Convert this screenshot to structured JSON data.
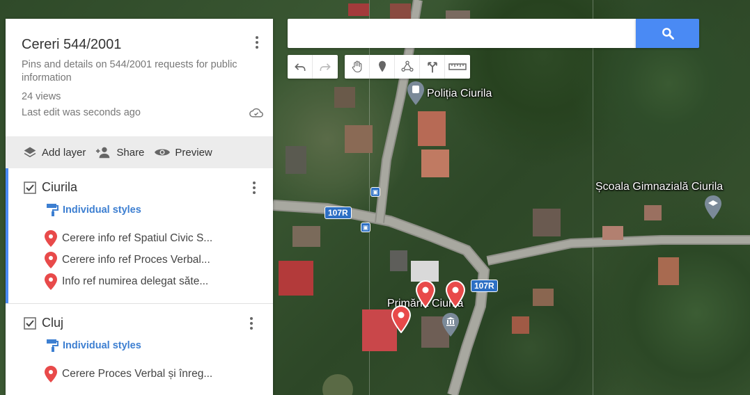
{
  "map": {
    "labels": {
      "police": "Poliția Ciurila",
      "school": "Școala Gimnazială Ciurila",
      "townhall": "Primăria Ciurila"
    },
    "route_shields": [
      "107R",
      "107R"
    ]
  },
  "search": {
    "value": "",
    "placeholder": ""
  },
  "toolbar": {
    "icons": [
      "undo-icon",
      "redo-icon",
      "hand-icon",
      "marker-icon",
      "draw-line-icon",
      "directions-icon",
      "ruler-icon"
    ]
  },
  "panel": {
    "title": "Cereri 544/2001",
    "description": "Pins and details on 544/2001 requests for public information",
    "views": "24 views",
    "last_edit": "Last edit was seconds ago",
    "actions": {
      "add_layer": "Add layer",
      "share": "Share",
      "preview": "Preview"
    },
    "layers": [
      {
        "name": "Ciurila",
        "styles": "Individual styles",
        "items": [
          "Cerere info ref Spatiul Civic S...",
          "Cerere info ref Proces Verbal...",
          "Info ref numirea delegat săte..."
        ]
      },
      {
        "name": "Cluj",
        "styles": "Individual styles",
        "items": [
          "Cerere Proces Verbal și înreg..."
        ]
      }
    ]
  },
  "colors": {
    "accent": "#4a8af4",
    "pin_red": "#e84a4a",
    "link_blue": "#3d7fd1"
  }
}
